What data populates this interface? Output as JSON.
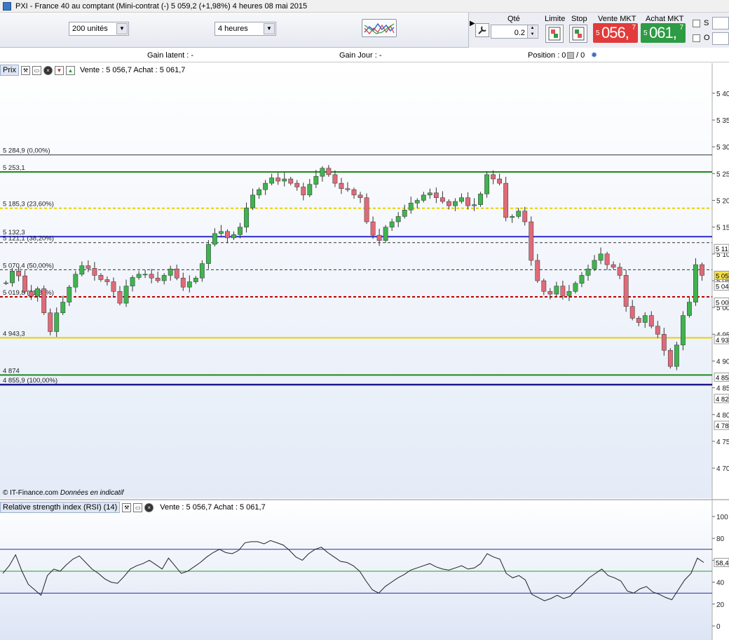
{
  "window": {
    "title": "PXI - France 40 au comptant (Mini-contrat  (-)    5 059,2 (+1,98%)      4 heures   08 mai 2015"
  },
  "toolbar": {
    "size_select": "200 unités",
    "timeframe_select": "4 heures",
    "qty_label": "Qté",
    "qty_value": "0.2",
    "limit_label": "Limite",
    "stop_label": "Stop",
    "sell_label": "Vente MKT",
    "buy_label": "Achat MKT",
    "sell_prefix": "5",
    "sell_big": "056,",
    "sell_sup": "7",
    "buy_prefix": "5",
    "buy_big": "061,",
    "buy_sup": "7",
    "check_s": "S",
    "check_o": "O",
    "colors": {
      "sell": "#e23b3b",
      "buy": "#2e9b45"
    }
  },
  "info": {
    "gain_latent": "Gain latent : -",
    "gain_jour": "Gain Jour : -",
    "position": "Position : 0",
    "position_tail": "/ 0"
  },
  "price_panel": {
    "title": "Prix",
    "quote": "Vente : 5 056,7 Achat : 5 061,7",
    "credits": "© IT-Finance.com",
    "disclaimer": "Données en indicatif"
  },
  "rsi_panel": {
    "title": "Relative strength index (RSI) (14)",
    "quote": "Vente : 5 056,7 Achat : 5 061,7"
  },
  "chart_data": [
    {
      "type": "candlestick",
      "ylim": [
        4670,
        5430
      ],
      "y_ticks": [
        "5 40",
        "5 35",
        "5 30",
        "5 25",
        "5 20",
        "5 15",
        "5 10",
        "5 05",
        "5 00",
        "4 95",
        "4 90",
        "4 85",
        "4 80",
        "4 75",
        "4 70"
      ],
      "price_labels_right": [
        "5 05",
        "5 04",
        "5 11",
        "5 00",
        "4 93",
        "4 85",
        "4 82",
        "4 78"
      ],
      "fib_levels": [
        {
          "label": "5 284,9 (0,00%)",
          "value": 5284.9,
          "color": "#333333"
        },
        {
          "label": "5 253,1",
          "value": 5253.1,
          "color": "#1a8a1a"
        },
        {
          "label": "5 185,3 (23,60%)",
          "value": 5185.3,
          "color": "#e8d200"
        },
        {
          "label": "5 132,3",
          "value": 5132.3,
          "color": "#2a2ad0"
        },
        {
          "label": "5 121,1 (38,20%)",
          "value": 5121.1,
          "color": "#333333"
        },
        {
          "label": "5 070,4 (50,00%)",
          "value": 5070.4,
          "color": "#333333"
        },
        {
          "label": "5 019,8 (61,80%)",
          "value": 5019.8,
          "color": "#c00000"
        },
        {
          "label": "4 943,3",
          "value": 4943.3,
          "color": "#e8d200"
        },
        {
          "label": "4 874",
          "value": 4874,
          "color": "#1a8a1a"
        },
        {
          "label": "4 855,9 (100,00%)",
          "value": 4855.9,
          "color": "#1a1a8a"
        }
      ],
      "candles": [
        5046,
        5068,
        5059,
        5030,
        5021,
        5035,
        4990,
        4955,
        4990,
        5010,
        5038,
        5062,
        5078,
        5073,
        5060,
        5052,
        5048,
        5030,
        5008,
        5040,
        5056,
        5062,
        5062,
        5055,
        5050,
        5060,
        5072,
        5055,
        5038,
        5048,
        5055,
        5082,
        5118,
        5138,
        5142,
        5130,
        5136,
        5150,
        5186,
        5210,
        5220,
        5232,
        5242,
        5236,
        5240,
        5232,
        5225,
        5210,
        5230,
        5245,
        5260,
        5248,
        5232,
        5222,
        5220,
        5210,
        5205,
        5160,
        5135,
        5125,
        5150,
        5160,
        5170,
        5182,
        5195,
        5200,
        5210,
        5214,
        5205,
        5198,
        5190,
        5198,
        5205,
        5190,
        5192,
        5212,
        5248,
        5240,
        5232,
        5168,
        5170,
        5180,
        5160,
        5088,
        5050,
        5030,
        5025,
        5040,
        5022,
        5030,
        5045,
        5060,
        5072,
        5088,
        5100,
        5080,
        5075,
        5060,
        5002,
        4980,
        4972,
        4985,
        4965,
        4950,
        4920,
        4890,
        4930,
        4985,
        5010,
        5080,
        5060
      ],
      "candle_start": 5046
    },
    {
      "type": "line",
      "series": [
        {
          "values": [
            48,
            55,
            65,
            50,
            38,
            33,
            28,
            46,
            52,
            50,
            56,
            61,
            64,
            58,
            52,
            48,
            43,
            40,
            39,
            45,
            52,
            55,
            57,
            60,
            56,
            52,
            62,
            55,
            48,
            50,
            54,
            58,
            63,
            67,
            70,
            67,
            66,
            69,
            76,
            77,
            77,
            75,
            78,
            76,
            74,
            69,
            63,
            60,
            66,
            70,
            72,
            67,
            63,
            59,
            58,
            55,
            50,
            41,
            33,
            30,
            36,
            40,
            44,
            47,
            51,
            53,
            55,
            57,
            54,
            52,
            51,
            53,
            55,
            52,
            53,
            57,
            66,
            63,
            61,
            48,
            44,
            46,
            42,
            29,
            26,
            23,
            25,
            28,
            25,
            27,
            33,
            38,
            44,
            48,
            52,
            46,
            44,
            41,
            32,
            30,
            34,
            36,
            31,
            29,
            26,
            24,
            33,
            42,
            48,
            62,
            58
          ]
        }
      ],
      "ylim": [
        0,
        100
      ],
      "y_ticks": [
        0,
        20,
        40,
        60,
        80,
        100
      ],
      "last_value_label": "58,4",
      "hlines": [
        70,
        50,
        30
      ]
    }
  ]
}
